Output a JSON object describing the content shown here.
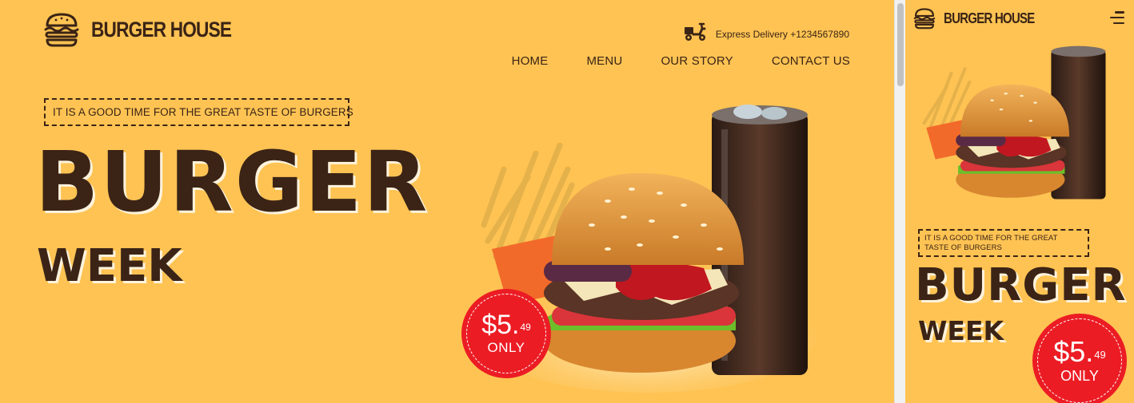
{
  "brand": {
    "name": "BURGER HOUSE"
  },
  "delivery": {
    "text": "Express Delivery +1234567890"
  },
  "nav": [
    {
      "label": "HOME"
    },
    {
      "label": "MENU"
    },
    {
      "label": "OUR STORY"
    },
    {
      "label": "CONTACT US"
    }
  ],
  "hero": {
    "tagline": "IT IS A GOOD TIME FOR THE GREAT TASTE OF BURGERS",
    "headline": "BURGER",
    "subheadline": "WEEK",
    "price": {
      "dollars": "$5.",
      "cents": "49",
      "note": "ONLY"
    }
  },
  "colors": {
    "background": "#fec353",
    "text": "#3b2416",
    "badge": "#ec1c24"
  },
  "icons": {
    "brand": "burger-icon",
    "delivery": "delivery-scooter-icon",
    "menu": "hamburger-menu-icon"
  }
}
